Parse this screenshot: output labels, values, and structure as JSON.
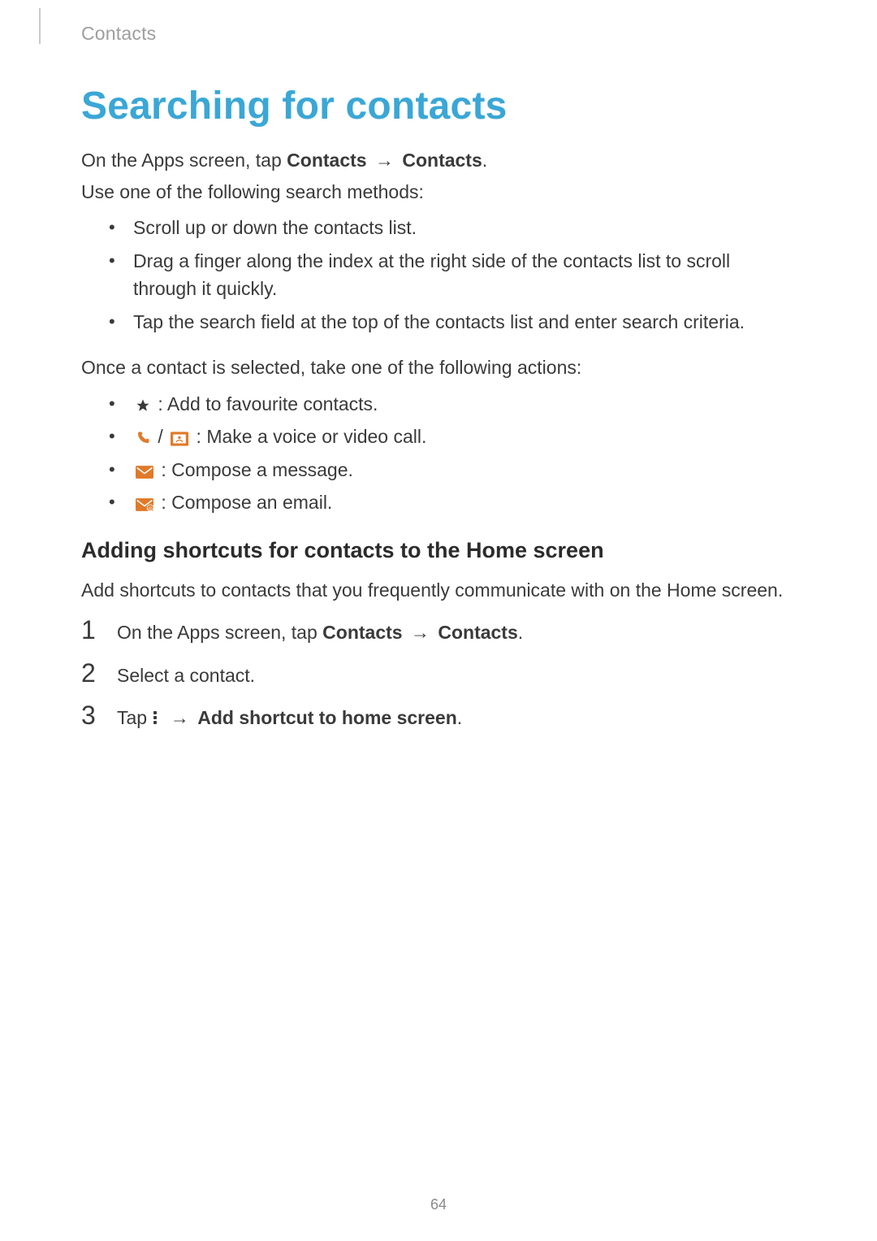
{
  "breadcrumb": "Contacts",
  "title": "Searching for contacts",
  "intro": {
    "line1_prefix": "On the Apps screen, tap ",
    "line1_b1": "Contacts",
    "line1_arrow": "→",
    "line1_b2": "Contacts",
    "line1_suffix": ".",
    "line2": "Use one of the following search methods:"
  },
  "methods": [
    "Scroll up or down the contacts list.",
    "Drag a finger along the index at the right side of the contacts list to scroll through it quickly.",
    "Tap the search field at the top of the contacts list and enter search criteria."
  ],
  "after_methods": "Once a contact is selected, take one of the following actions:",
  "actions": {
    "star": " : Add to favourite contacts.",
    "call_sep": " / ",
    "call_text": " : Make a voice or video call.",
    "msg": " : Compose a message.",
    "email": " : Compose an email."
  },
  "subhead": "Adding shortcuts for contacts to the Home screen",
  "subhead_body": "Add shortcuts to contacts that you frequently communicate with on the Home screen.",
  "steps": {
    "s1_prefix": "On the Apps screen, tap ",
    "s1_b1": "Contacts",
    "s1_arrow": "→",
    "s1_b2": "Contacts",
    "s1_suffix": ".",
    "s2": "Select a contact.",
    "s3_prefix": "Tap ",
    "s3_arrow": "→",
    "s3_bold": "Add shortcut to home screen",
    "s3_suffix": "."
  },
  "nums": {
    "n1": "1",
    "n2": "2",
    "n3": "3"
  },
  "pagenum": "64",
  "colors": {
    "accent": "#3aa7d6",
    "orange": "#e07a2a"
  }
}
